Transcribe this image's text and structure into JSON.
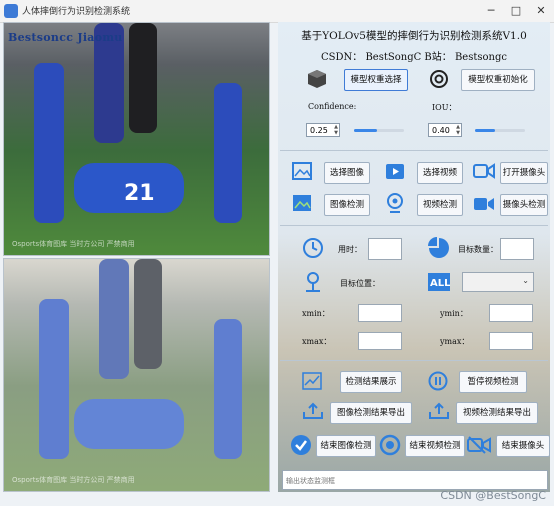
{
  "window": {
    "title": "人体摔倒行为识别检测系统"
  },
  "logo_text": "Bestsoncc Jiaomu",
  "left": {
    "top_watermark": "Osports体育图库 当时方公司 严禁商用",
    "bottom_watermark": "Osports体育图库 当时方公司 严禁商用",
    "jersey_number": "21"
  },
  "header": {
    "title": "基于YOLOv5模型的摔倒行为识别检测系统V1.0",
    "subline": "CSDN：  BestSongC   B站：  Bestsongc"
  },
  "model": {
    "select_label": "模型权重选择",
    "init_label": "模型权重初始化"
  },
  "params": {
    "confidence_label": "Confidence:",
    "confidence_value": "0.25",
    "confidence_level": 0.45,
    "iou_label": "IOU：",
    "iou_value": "0.40",
    "iou_level": 0.4
  },
  "actions": {
    "select_image": "选择图像",
    "select_video": "选择视频",
    "open_camera": "打开摄像头",
    "image_detect": "图像检测",
    "video_detect": "视频检测",
    "camera_detect": "摄像头检测"
  },
  "info": {
    "time_label": "用时：",
    "count_label": "目标数量：",
    "position_label": "目标位置：",
    "xmin_label": "xmin：",
    "ymin_label": "ymin：",
    "xmax_label": "xmax：",
    "ymax_label": "ymax："
  },
  "results": {
    "show_label": "检测结果展示",
    "pause_label": "暂停视频检测",
    "export_image": "图像检测结果导出",
    "export_video": "视频检测结果导出",
    "end_image": "结束图像检测",
    "end_video": "结束视频检测",
    "end_camera": "结束摄像头"
  },
  "status_bar": {
    "text": "输出状态监测框"
  },
  "watermark": "CSDN @BestSongC",
  "colors": {
    "accent": "#3a86e8",
    "icon_blue": "#2f7fdc",
    "logo": "#1b3c88"
  }
}
